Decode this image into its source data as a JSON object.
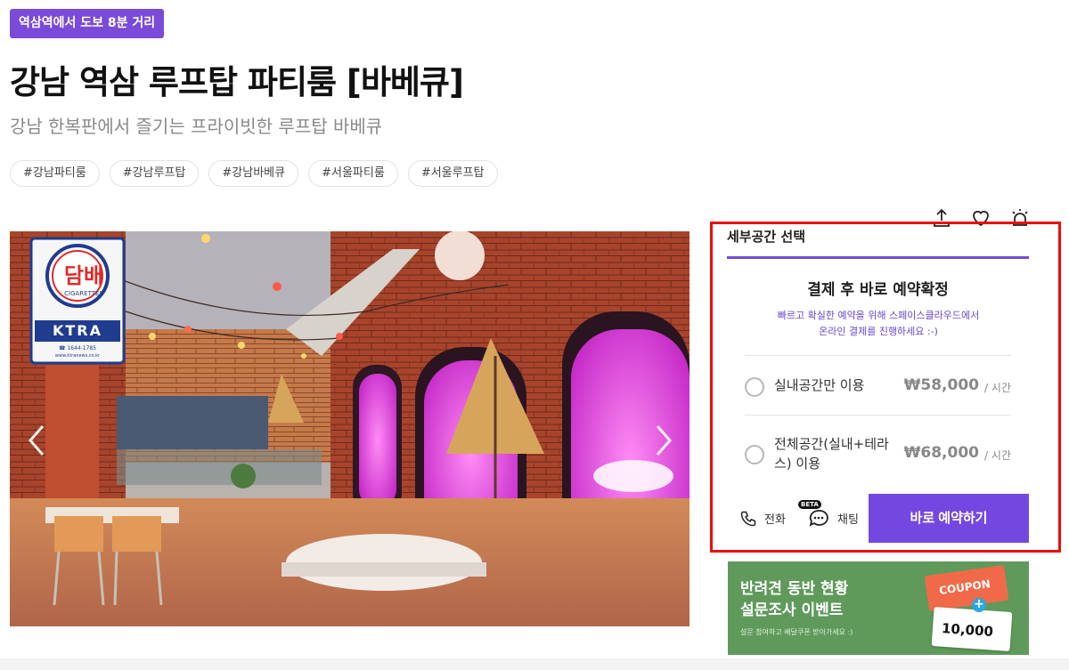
{
  "location_badge": "역삼역에서 도보 8분 거리",
  "title": "강남 역삼 루프탑 파티룸 [바베큐]",
  "subtitle": "강남 한복판에서 즐기는 프라이빗한 루프탑 바베큐",
  "tags": [
    "#강남파티룸",
    "#강남루프탑",
    "#강남바베큐",
    "#서울파티룸",
    "#서울루프탑"
  ],
  "icons": [
    "share-icon",
    "heart-icon",
    "alarm-icon"
  ],
  "photo": {
    "sign_main": "담배",
    "sign_sub": "CIGARETTES",
    "sign_ktra": "KTRA",
    "sign_phone": "☎ 1644-1785",
    "sign_web": "www.ktranews.co.kr"
  },
  "booking": {
    "panel_title": "세부공간 선택",
    "confirm_title": "결제 후 바로 예약확정",
    "confirm_desc_line1": "빠르고 확실한 예약을 위해 스페이스클라우드에서",
    "confirm_desc_line2": "온라인 결제를 진행하세요 :-)",
    "options": [
      {
        "label_line1": "실내공간만 이용",
        "label_line2": "",
        "price": "₩58,000",
        "unit": "/ 시간"
      },
      {
        "label_line1": "전체공간(실내+테라",
        "label_line2": "스) 이용",
        "price": "₩68,000",
        "unit": "/ 시간"
      }
    ],
    "call_label": "전화",
    "chat_label": "채팅",
    "beta_label": "BETA",
    "reserve_label": "바로 예약하기"
  },
  "banner": {
    "title": "반려견 동반 현황\n설문조사 이벤트",
    "sub": "설문 참여하고 배달쿠폰 받아가세요 :)",
    "coupon_word": "COUPON",
    "coupon_amount": "10,000",
    "coupon_side": "COUPON"
  },
  "colors": {
    "accent": "#7448e0",
    "highlight_frame": "#ee0b0b",
    "banner_bg": "#5f9a5b"
  }
}
